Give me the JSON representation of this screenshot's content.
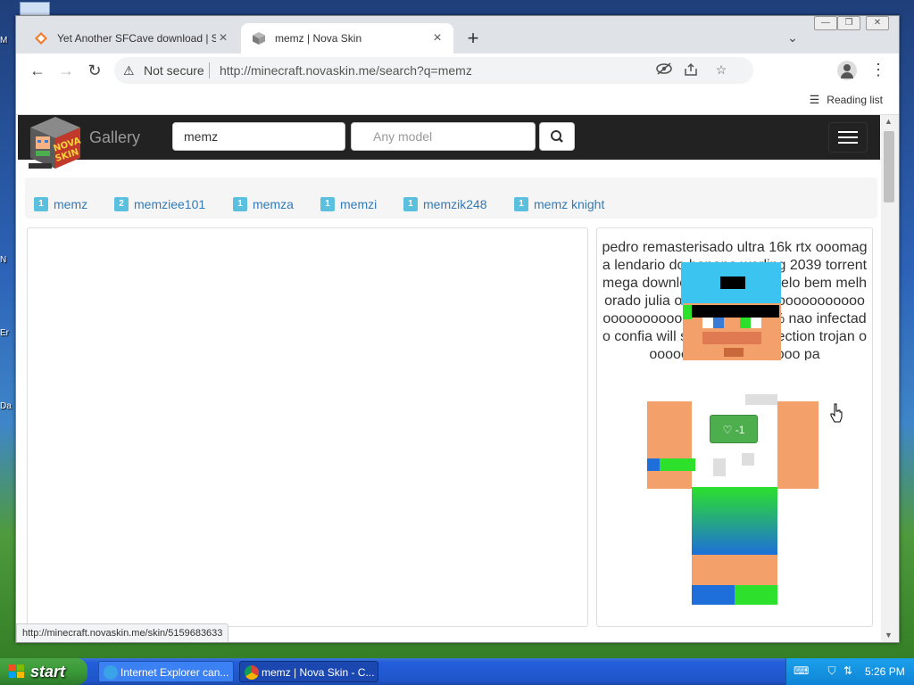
{
  "desktop": {
    "icon_labels": [
      "M",
      "N",
      "Er",
      "Da"
    ]
  },
  "browser": {
    "tabs": [
      {
        "title": "Yet Another SFCave download | So",
        "active": false
      },
      {
        "title": "memz | Nova Skin",
        "active": true
      }
    ],
    "new_tab": "+",
    "tab_search": "⌄",
    "window_controls": [
      "—",
      "❐",
      "✕"
    ],
    "nav": {
      "back": "←",
      "forward": "→",
      "reload": "↻"
    },
    "address": {
      "security_icon": "warning-icon",
      "security_label": "Not secure",
      "url": "http://minecraft.novaskin.me/search?q=memz"
    },
    "reading_list": "Reading list",
    "status_url": "http://minecraft.novaskin.me/skin/5159683633"
  },
  "site": {
    "logo_text_top": "NOVA",
    "logo_text_bottom": "SKIN",
    "gallery_label": "Gallery",
    "search_value": "memz",
    "model_placeholder": "Any model",
    "tags": [
      {
        "count": "1",
        "label": "memz"
      },
      {
        "count": "2",
        "label": "memziee101"
      },
      {
        "count": "1",
        "label": "memza"
      },
      {
        "count": "1",
        "label": "memzi"
      },
      {
        "count": "1",
        "label": "memzik248"
      },
      {
        "count": "1",
        "label": "memz knight"
      }
    ],
    "skin_card": {
      "title": "pedro remasterisado ultra 16k rtx ooomaga lendario do banana worling 2039 torrent mega download carlos amrselo bem melhorado julia oooooooooooooooooooooooooooooooooo no virus 1000% nao infectado confia will smith meme infection trojan oooooooooooooooooooo pa",
      "likes": "-1",
      "like_color": "#4cae4c"
    }
  },
  "taskbar": {
    "start_label": "start",
    "buttons": [
      {
        "label": "Internet Explorer can..."
      },
      {
        "label": "memz | Nova Skin - C..."
      }
    ],
    "clock": "5:26 PM"
  }
}
